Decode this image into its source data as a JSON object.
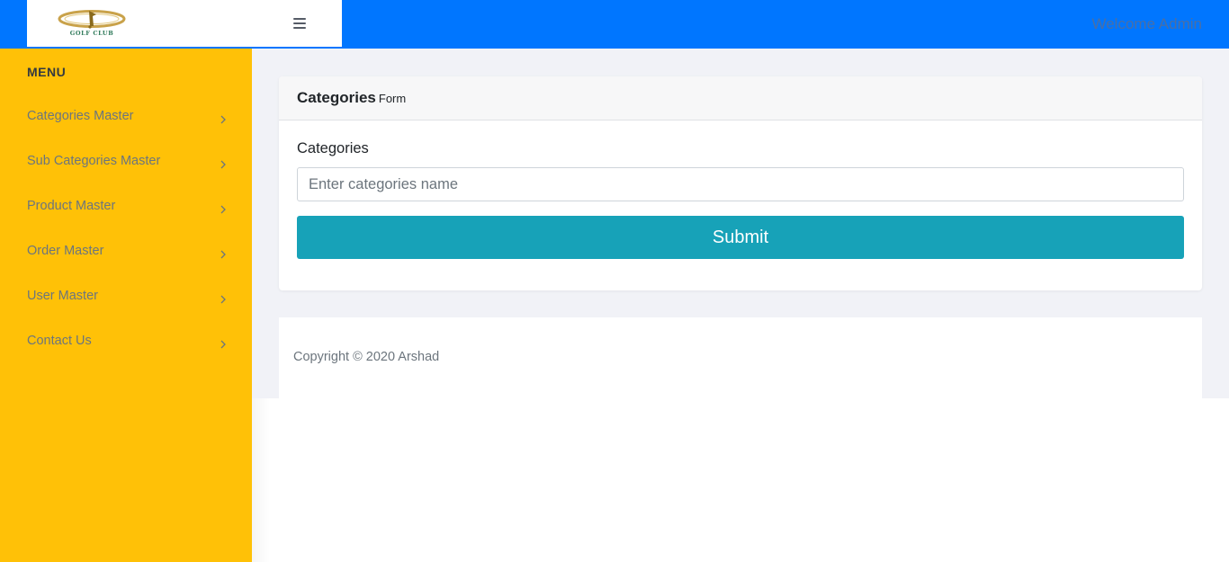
{
  "header": {
    "logo_text": "GOLF CLUB",
    "welcome": "Welcome Admin"
  },
  "sidebar": {
    "title": "MENU",
    "items": [
      {
        "label": "Categories Master"
      },
      {
        "label": "Sub Categories Master"
      },
      {
        "label": "Product Master"
      },
      {
        "label": "Order Master"
      },
      {
        "label": "User Master"
      },
      {
        "label": "Contact Us"
      }
    ]
  },
  "form": {
    "title": "Categories",
    "subtitle": "Form",
    "field_label": "Categories",
    "input_value": "",
    "input_placeholder": "Enter categories name",
    "submit_label": "Submit"
  },
  "footer": {
    "copyright": "Copyright © 2020 Arshad"
  },
  "colors": {
    "topbar": "#0076ff",
    "sidebar": "#ffc107",
    "submit": "#17a2b8",
    "content_bg": "#f1f2f7"
  },
  "icons": {
    "menu_toggle": "hamburger-icon",
    "menu_chevron": "chevron-right-icon",
    "logo": "golf-club-logo"
  }
}
